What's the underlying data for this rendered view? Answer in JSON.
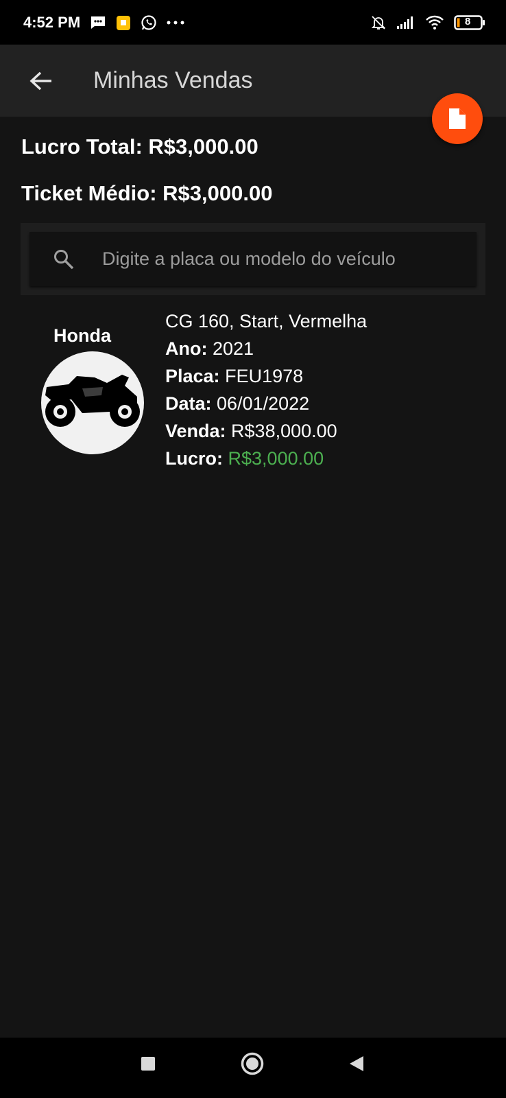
{
  "status_bar": {
    "time": "4:52 PM",
    "battery": "8",
    "icons_left": [
      "message-icon",
      "app-notification-icon",
      "whatsapp-icon",
      "more-dots-icon"
    ],
    "icons_right": [
      "bell-off-icon",
      "signal-icon",
      "wifi-icon",
      "battery-icon"
    ]
  },
  "app_bar": {
    "title": "Minhas Vendas"
  },
  "fab": {
    "icon": "document-icon",
    "color": "#ff4d0d"
  },
  "summary": {
    "total_profit": "Lucro Total: R$3,000.00",
    "average_ticket": "Ticket Médio: R$3,000.00"
  },
  "search": {
    "placeholder": "Digite a placa ou modelo do veículo",
    "value": ""
  },
  "sales": [
    {
      "brand": "Honda",
      "model": "CG 160, Start, Vermelha",
      "year_label": "Ano:",
      "year": "2021",
      "plate_label": "Placa:",
      "plate": "FEU1978",
      "date_label": "Data:",
      "date": "06/01/2022",
      "sale_label": "Venda:",
      "sale": "R$38,000.00",
      "profit_label": "Lucro:",
      "profit": "R$3,000.00",
      "profit_color": "#4caf50"
    }
  ],
  "nav": {
    "icons": [
      "recents-square-icon",
      "home-circle-icon",
      "back-triangle-icon"
    ]
  }
}
